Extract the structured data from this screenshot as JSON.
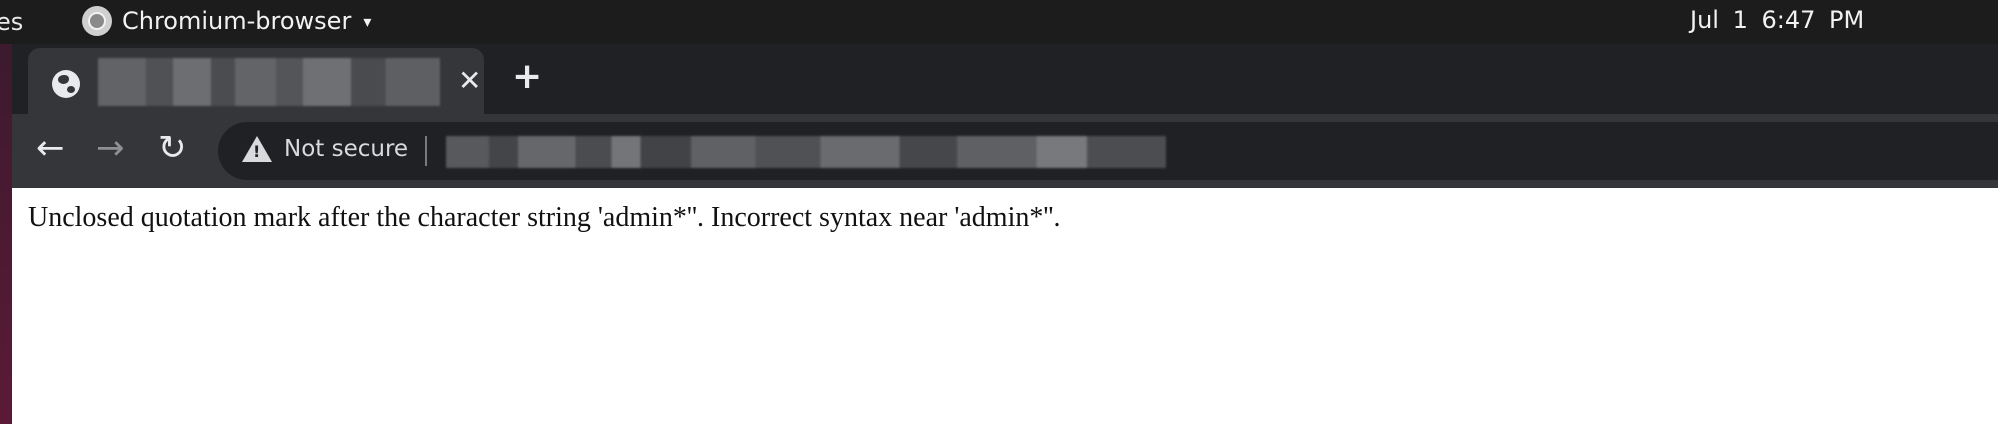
{
  "top_panel": {
    "activities_label": "es",
    "app_name": "Chromium-browser",
    "dropdown_glyph": "▾",
    "date": "Jul 1",
    "time": "6:47 PM"
  },
  "browser": {
    "tab": {
      "favicon": "globe-icon",
      "close_glyph": "✕"
    },
    "new_tab_glyph": "+",
    "toolbar": {
      "back_glyph": "←",
      "forward_glyph": "→",
      "reload_glyph": "↻",
      "security_label": "Not secure"
    }
  },
  "page": {
    "error_message": "Unclosed quotation mark after the character string 'admin*''. Incorrect syntax near 'admin*''."
  },
  "colors": {
    "panel": "#1c1c1c",
    "tabstrip": "#202124",
    "active_tab": "#35363a",
    "omnibox": "#202124"
  }
}
